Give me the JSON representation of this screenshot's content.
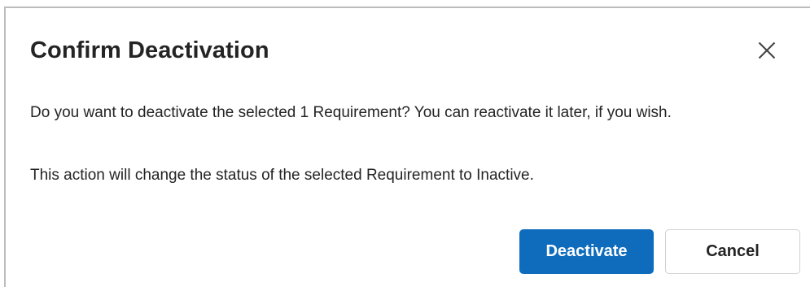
{
  "dialog": {
    "title": "Confirm Deactivation",
    "close_icon": "close-icon",
    "message_line1": "Do you want to deactivate the selected 1 Requirement? You can reactivate it later, if you wish.",
    "message_line2": "This action will change the status of the selected Requirement to Inactive.",
    "primary_button": "Deactivate",
    "secondary_button": "Cancel"
  },
  "colors": {
    "primary": "#0f6cbd",
    "text": "#242424",
    "border": "#d1d1d1"
  }
}
